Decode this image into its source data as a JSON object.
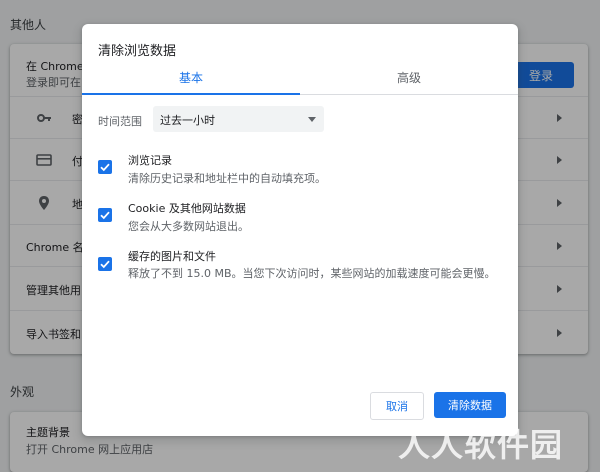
{
  "background": {
    "section_people": "其他人",
    "signin_card": {
      "line1": "在 Chrome",
      "line2": "登录即可在",
      "login_button": "登录"
    },
    "rows_card1": [
      {
        "icon": "key-icon",
        "text": "密"
      },
      {
        "icon": "card-icon",
        "text": "付"
      },
      {
        "icon": "location-icon",
        "text": "地"
      }
    ],
    "rows_card2": [
      {
        "text": "Chrome 名"
      },
      {
        "text": "管理其他用"
      },
      {
        "text": "导入书签和"
      }
    ],
    "section_appearance": "外观",
    "appearance_row": {
      "title": "主题背景",
      "subtitle": "打开 Chrome 网上应用店"
    }
  },
  "dialog": {
    "title": "清除浏览数据",
    "tabs": [
      {
        "label": "基本",
        "active": true
      },
      {
        "label": "高级",
        "active": false
      }
    ],
    "time_range": {
      "label": "时间范围",
      "value": "过去一小时"
    },
    "items": [
      {
        "title": "浏览记录",
        "subtitle": "清除历史记录和地址栏中的自动填充项。",
        "checked": true
      },
      {
        "title": "Cookie 及其他网站数据",
        "subtitle": "您会从大多数网站退出。",
        "checked": true
      },
      {
        "title": "缓存的图片和文件",
        "subtitle": "释放了不到 15.0 MB。当您下次访问时，某些网站的加载速度可能会更慢。",
        "checked": true
      }
    ],
    "cancel_label": "取消",
    "clear_label": "清除数据"
  },
  "watermark": "人人软件园",
  "colors": {
    "accent": "#1a73e8",
    "scrim": "rgba(0,0,0,0.34)"
  }
}
